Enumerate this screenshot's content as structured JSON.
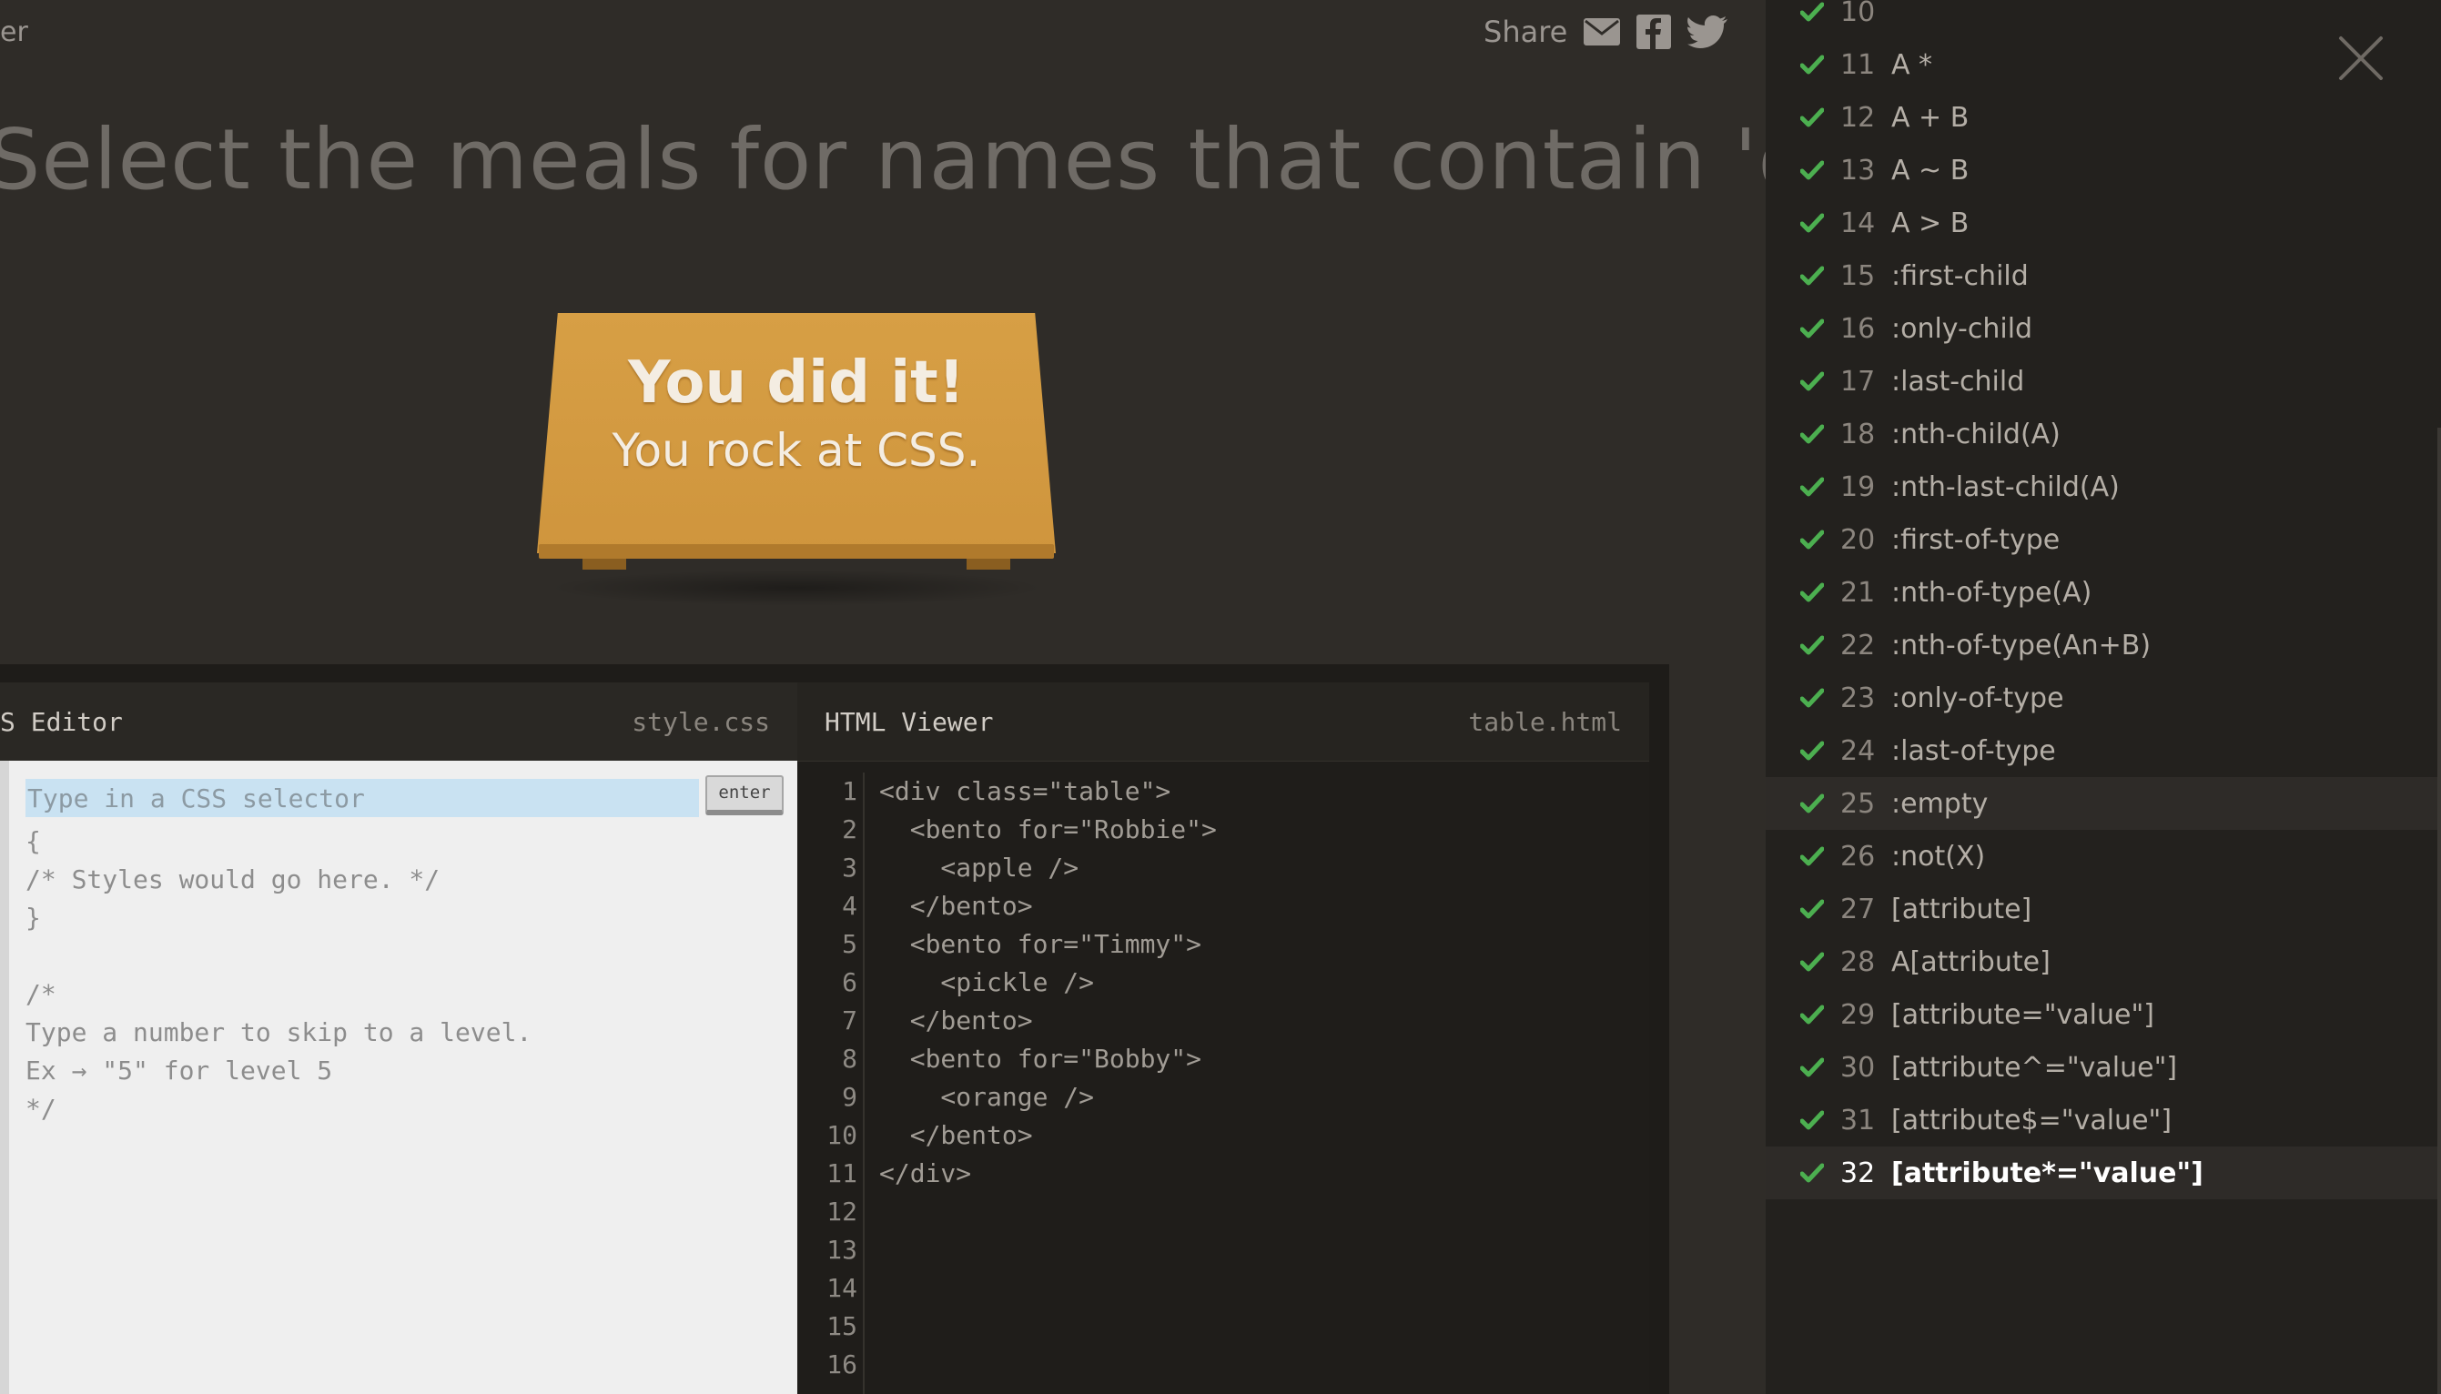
{
  "header": {
    "fragment_text": "er",
    "share_label": "Share",
    "share_icons": [
      "envelope-icon",
      "facebook-icon",
      "twitter-icon"
    ]
  },
  "instruction": "Select the meals for names that contain 'obb'",
  "win_message": {
    "title": "You did it!",
    "subtitle": "You rock at CSS."
  },
  "css_editor": {
    "title": "S Editor",
    "filename": "style.css",
    "input_placeholder": "Type in a CSS selector",
    "enter_label": "enter",
    "code_lines": [
      "{",
      "/* Styles would go here. */",
      "}",
      "",
      "/*",
      "Type a number to skip to a level.",
      "Ex → \"5\" for level 5",
      "*/"
    ]
  },
  "html_viewer": {
    "title": "HTML Viewer",
    "filename": "table.html",
    "line_numbers": [
      "1",
      "2",
      "3",
      "4",
      "5",
      "6",
      "7",
      "8",
      "9",
      "10",
      "11",
      "12",
      "13",
      "14",
      "15",
      "16"
    ],
    "code_lines": [
      "<div class=\"table\">",
      "  <bento for=\"Robbie\">",
      "    <apple />",
      "  </bento>",
      "  <bento for=\"Timmy\">",
      "    <pickle />",
      "  </bento>",
      "  <bento for=\"Bobby\">",
      "    <orange />",
      "  </bento>",
      "</div>",
      "",
      "",
      "",
      "",
      ""
    ]
  },
  "levels": [
    {
      "num": "10",
      "name": ""
    },
    {
      "num": "11",
      "name": "A *"
    },
    {
      "num": "12",
      "name": "A + B"
    },
    {
      "num": "13",
      "name": "A ~ B"
    },
    {
      "num": "14",
      "name": "A > B"
    },
    {
      "num": "15",
      "name": ":first-child"
    },
    {
      "num": "16",
      "name": ":only-child"
    },
    {
      "num": "17",
      "name": ":last-child"
    },
    {
      "num": "18",
      "name": ":nth-child(A)"
    },
    {
      "num": "19",
      "name": ":nth-last-child(A)"
    },
    {
      "num": "20",
      "name": ":first-of-type"
    },
    {
      "num": "21",
      "name": ":nth-of-type(A)"
    },
    {
      "num": "22",
      "name": ":nth-of-type(An+B)"
    },
    {
      "num": "23",
      "name": ":only-of-type"
    },
    {
      "num": "24",
      "name": ":last-of-type"
    },
    {
      "num": "25",
      "name": ":empty"
    },
    {
      "num": "26",
      "name": ":not(X)"
    },
    {
      "num": "27",
      "name": "[attribute]"
    },
    {
      "num": "28",
      "name": "A[attribute]"
    },
    {
      "num": "29",
      "name": "[attribute=\"value\"]"
    },
    {
      "num": "30",
      "name": "[attribute^=\"value\"]"
    },
    {
      "num": "31",
      "name": "[attribute$=\"value\"]"
    },
    {
      "num": "32",
      "name": "[attribute*=\"value\"]"
    }
  ],
  "current_level": "32",
  "hover_level": "25",
  "colors": {
    "check": "#4caf50",
    "table": "#d49a41",
    "background": "#2f2c28",
    "sidebar": "#23211e"
  }
}
